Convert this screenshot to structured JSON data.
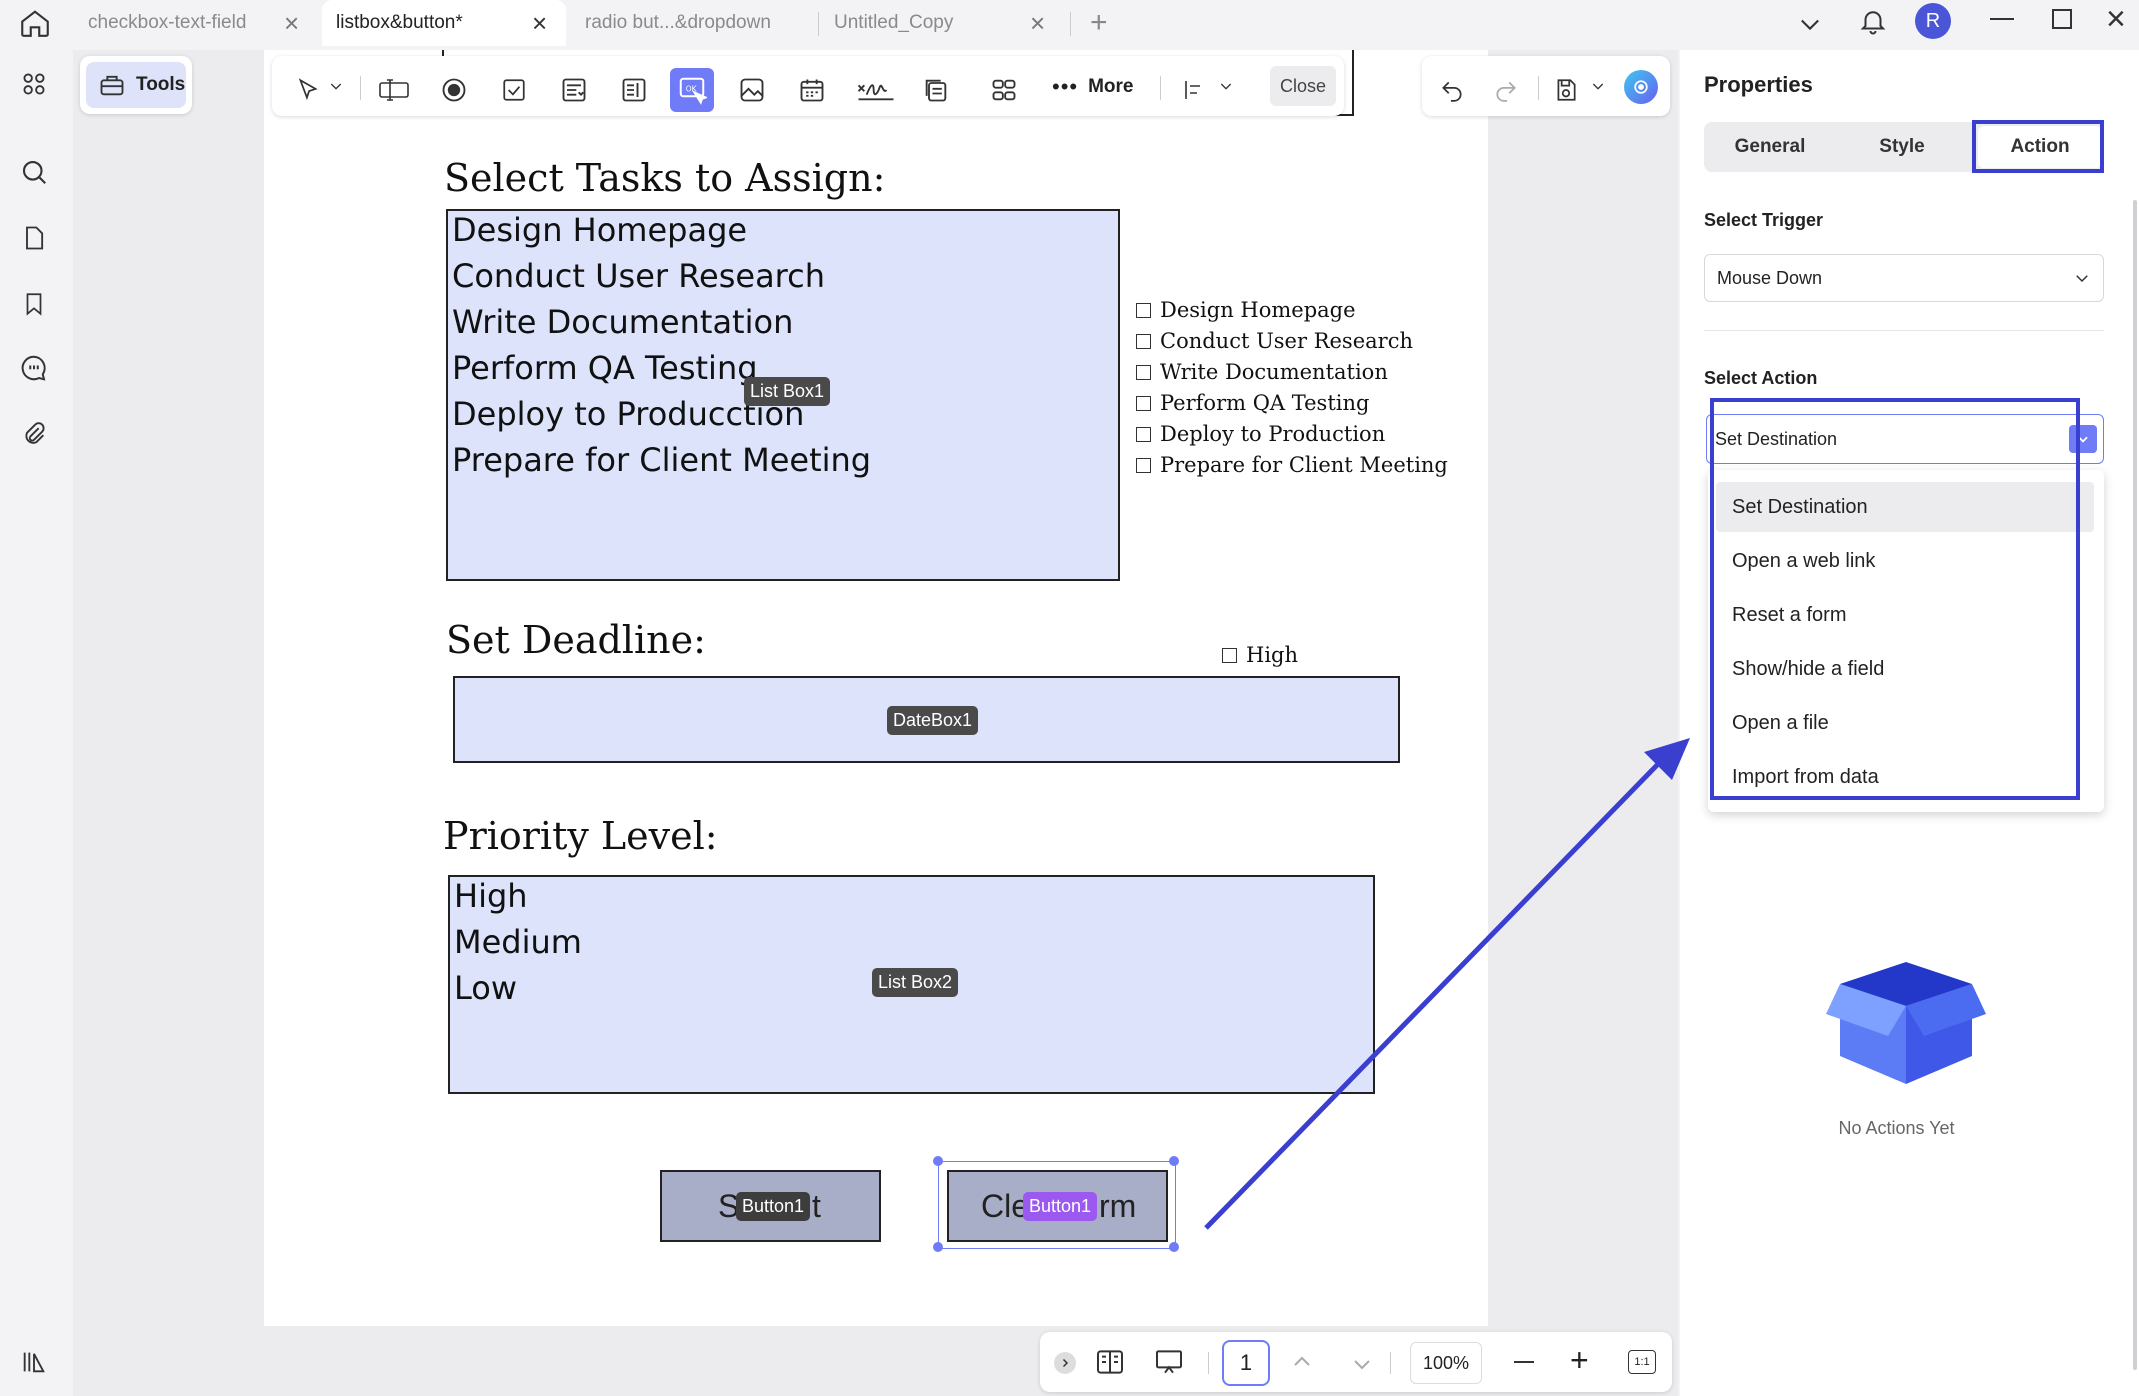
{
  "tabs": [
    {
      "label": "checkbox-text-field"
    },
    {
      "label": "listbox&button*"
    },
    {
      "label": "radio but...&dropdown"
    },
    {
      "label": "Untitled_Copy"
    }
  ],
  "window": {
    "avatar_letter": "R"
  },
  "tools": {
    "label": "Tools"
  },
  "toolbar": {
    "more_label": "More",
    "close_label": "Close"
  },
  "form": {
    "heading_tasks": "Select Tasks to Assign:",
    "listbox1": {
      "tag": "List Box1",
      "items": [
        "Design Homepage",
        "Conduct User Research",
        "Write Documentation",
        "Perform QA Testing",
        "Deploy to Producction",
        "Prepare for Client Meeting"
      ]
    },
    "checkboxes": [
      "Design Homepage",
      "Conduct User Research",
      "Write Documentation",
      "Perform QA Testing",
      "Deploy to Production",
      "Prepare for Client Meeting"
    ],
    "heading_deadline": "Set Deadline:",
    "high_checkbox": "High",
    "datebox_tag": "DateBox1",
    "heading_priority": "Priority Level:",
    "listbox2": {
      "tag": "List Box2",
      "items": [
        "High",
        "Medium",
        "Low"
      ]
    },
    "submit": {
      "text_left": "S",
      "text_right": "t",
      "tag": "Button1"
    },
    "clear": {
      "text_left": "Cle",
      "text_right": "rm",
      "tag": "Button1"
    }
  },
  "bottombar": {
    "page_number": "1",
    "zoom": "100%",
    "fit_label": "1:1"
  },
  "panel": {
    "title": "Properties",
    "tabs": [
      "General",
      "Style",
      "Action"
    ],
    "active_tab": "Action",
    "trigger_label": "Select Trigger",
    "trigger_value": "Mouse Down",
    "action_label": "Select Action",
    "action_value": "Set Destination",
    "action_options": [
      "Set Destination",
      "Open a web link",
      "Reset a form",
      "Show/hide a field",
      "Open a file",
      "Import from data"
    ],
    "empty_text": "No Actions Yet"
  },
  "colors": {
    "accent": "#3a3fd0",
    "field_fill": "#dce3fb",
    "button_fill": "#a9aec8",
    "highlight": "#6f7bf7"
  }
}
